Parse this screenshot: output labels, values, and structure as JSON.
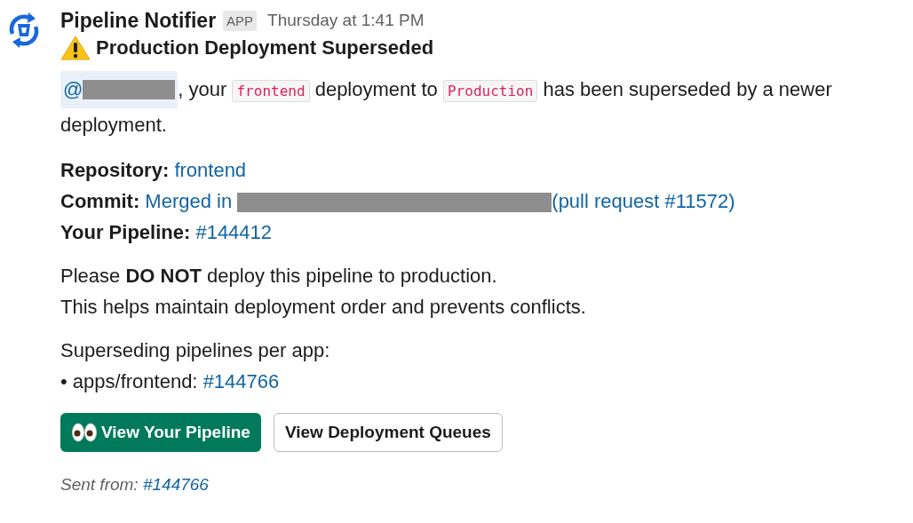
{
  "message": {
    "sender": "Pipeline Notifier",
    "badge": "APP",
    "timestamp": "Thursday at 1:41 PM",
    "title": "Production Deployment Superseded",
    "intro": {
      "mention": "@",
      "mention_redacted": true,
      "text_1": ", your ",
      "code_1": "frontend",
      "text_2": " deployment to ",
      "code_2": "Production",
      "text_3": " has been superseded by a newer deployment."
    },
    "fields": [
      {
        "label": "Repository:",
        "link": "frontend",
        "redacted": false
      },
      {
        "label": "Commit:",
        "link": "Merged in",
        "redacted": true,
        "link_after": "(pull request #11572)"
      },
      {
        "label": "Your Pipeline:",
        "link": "#144412",
        "redacted": false
      }
    ],
    "notice": [
      "Please **DO NOT** deploy this pipeline to production.",
      "This helps maintain deployment order and prevents conflicts."
    ],
    "superseding": {
      "heading": "Superseding pipelines per app:",
      "items": [
        {
          "bullet": "•",
          "label": "apps/frontend:",
          "link": "#144766"
        }
      ]
    },
    "buttons": [
      {
        "label": "View Your Pipeline",
        "kind": "primary"
      },
      {
        "label": "View Deployment Queues",
        "kind": "secondary"
      }
    ],
    "footer": {
      "label": "Sent from:",
      "link": "#144766"
    }
  }
}
